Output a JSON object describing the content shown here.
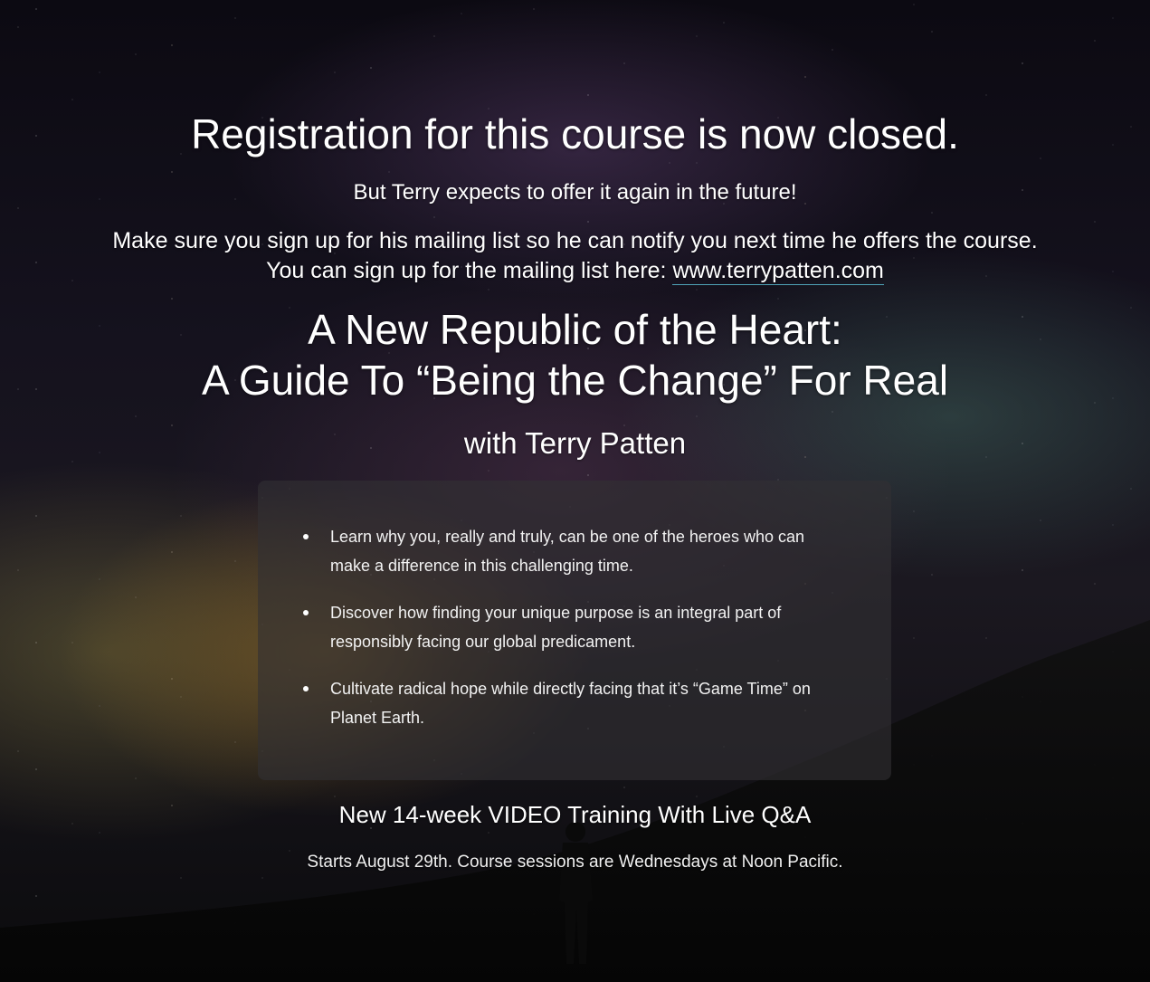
{
  "closed_notice": {
    "title": "Registration for this course is now closed.",
    "subtitle": "But Terry expects to offer it again in the future!",
    "signup_text": "Make sure you sign up for his mailing list so he can notify you next time he offers the course. You can sign up for the mailing list here: ",
    "signup_link": "www.terrypatten.com"
  },
  "course": {
    "title_line1": "A New Republic of the Heart:",
    "title_line2": "A Guide To “Being the Change” For Real",
    "with": "with Terry Patten"
  },
  "benefits": [
    "Learn why you, really and truly, can be one of the heroes who can make a difference in this challenging time.",
    "Discover how finding your unique purpose is an integral part of responsibly facing our global predicament.",
    "Cultivate radical hope while directly facing that it’s “Game Time” on Planet Earth."
  ],
  "training": {
    "heading": "New 14-week VIDEO Training With Live Q&A",
    "schedule": "Starts August 29th. Course sessions are Wednesdays at Noon Pacific."
  },
  "colors": {
    "text": "#ffffff",
    "link_underline": "#4fa3b8",
    "box_background": "#323034"
  },
  "icons": {
    "background": "starry-sky-with-silhouette-icon",
    "bullet": "bullet-dot-icon"
  }
}
